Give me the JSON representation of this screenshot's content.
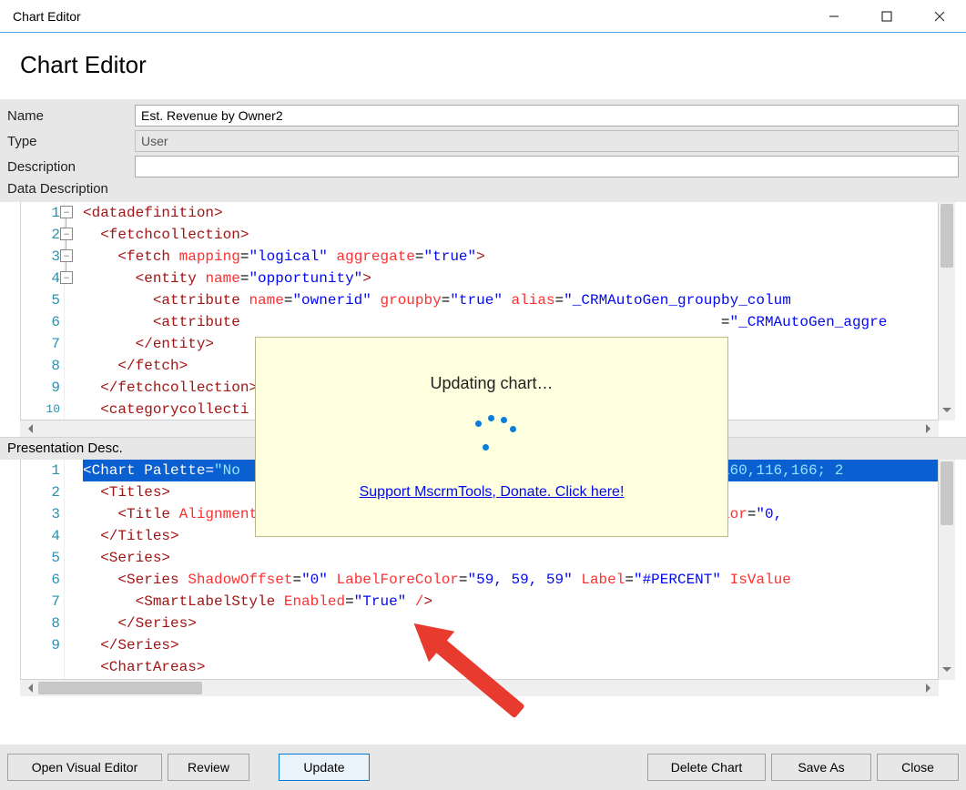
{
  "window": {
    "title": "Chart Editor"
  },
  "heading": "Chart Editor",
  "form": {
    "name_label": "Name",
    "name_value": "Est. Revenue by Owner2",
    "type_label": "Type",
    "type_value": "User",
    "desc_label": "Description",
    "desc_value": "",
    "data_label": "Data Description",
    "pres_label": "Presentation Desc."
  },
  "data_editor": {
    "lines": [
      "<datadefinition>",
      "  <fetchcollection>",
      "    <fetch mapping=\"logical\" aggregate=\"true\">",
      "      <entity name=\"opportunity\">",
      "        <attribute name=\"ownerid\" groupby=\"true\" alias=\"_CRMAutoGen_groupby_colum",
      "        <attribute                                                       =\"_CRMAutoGen_aggre",
      "      </entity>",
      "    </fetch>",
      "  </fetchcollection>",
      "  <categorycollecti"
    ]
  },
  "pres_editor": {
    "lines": [
      "<Chart Palette=\"No                                                  ,49; 160,116,166; 2",
      "  <Titles>",
      "    <Title Alignment=\"TopLeft\" DockingOffset=\"-3\" Font=\"{0}, 13px\" ForeColor=\"0,",
      "  </Titles>",
      "  <Series>",
      "    <Series ShadowOffset=\"0\" LabelForeColor=\"59, 59, 59\" Label=\"#PERCENT\" IsValue",
      "      <SmartLabelStyle Enabled=\"True\" />",
      "    </Series>",
      "  </Series>",
      "  <ChartAreas>"
    ]
  },
  "popup": {
    "message": "Updating chart…",
    "link": "Support MscrmTools, Donate. Click here!"
  },
  "buttons": {
    "open_visual": "Open Visual Editor",
    "review": "Review",
    "update": "Update",
    "delete": "Delete Chart",
    "save_as": "Save As",
    "close": "Close"
  }
}
